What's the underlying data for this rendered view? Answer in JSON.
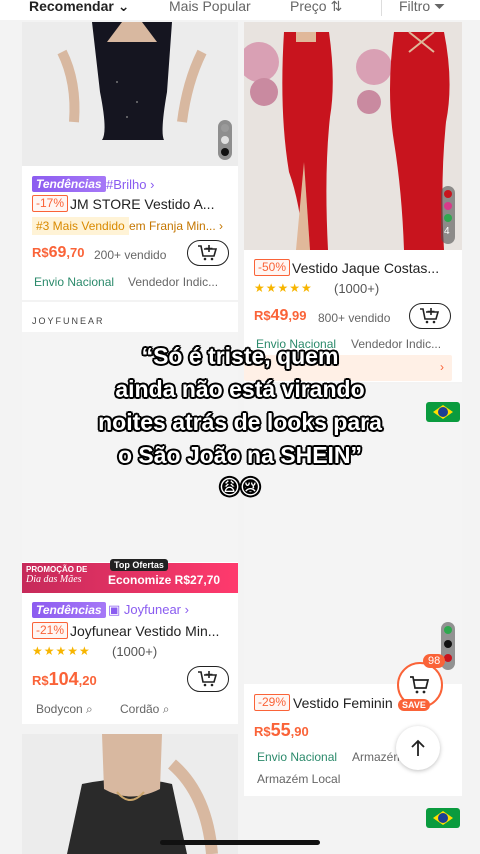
{
  "sort_bar": {
    "recommend": "Recomendar",
    "popular": "Mais Popular",
    "price": "Preço",
    "filter": "Filtro"
  },
  "products": [
    {
      "trend_tag": "Tendências",
      "trend_sub": "#Brilho",
      "discount": "-17%",
      "title": "JM STORE  Vestido A...",
      "rank_tag": "#3 Mais Vendido",
      "rank_ext": "em Franja Min...",
      "price_currency": "R$",
      "price_int": "69",
      "price_dec": ",70",
      "sold": "200+ vendido",
      "chip1": "Envio Nacional",
      "chip2": "Vendedor Indic..."
    },
    {
      "discount": "-50%",
      "title": "Vestido Jaque Costas...",
      "rating": "(1000+)",
      "price_currency": "R$",
      "price_int": "49",
      "price_dec": ",99",
      "sold": "800+ vendido",
      "chip1": "Envio Nacional",
      "chip2": "Vendedor Indic...",
      "img_count": "4"
    },
    {
      "brand_line": "JOYFUNEAR",
      "promo_line1": "PROMOÇÃO DE",
      "promo_line2": "Dia das Mães",
      "promo_tag": "Top Ofertas",
      "promo_save": "Economize R$27,70",
      "trend_tag": "Tendências",
      "trend_sub": "Joyfunear",
      "discount": "-21%",
      "title": "Joyfunear Vestido Min...",
      "rating": "(1000+)",
      "price_currency": "R$",
      "price_int": "104",
      "price_dec": ",20",
      "chip1": "Bodycon",
      "chip2": "Cordão"
    },
    {
      "discount": "-29%",
      "title": "Vestido Feminin",
      "price_currency": "R$",
      "price_int": "55",
      "price_dec": ",90",
      "chip1": "Envio Nacional",
      "chip2": "Armazém",
      "chip3": "Armazém Local"
    }
  ],
  "cart": {
    "badge": "98",
    "save": "SAVE"
  },
  "overlay": {
    "line1": "“Só é triste, quem",
    "line2": "ainda não está virando",
    "line3": "noites atrás de looks para",
    "line4": "o São João na SHEIN”",
    "emoji": "😩😢"
  },
  "colors": {
    "accent": "#fa6338",
    "trend": "#8c5cf0",
    "rank": "#d98a00"
  }
}
